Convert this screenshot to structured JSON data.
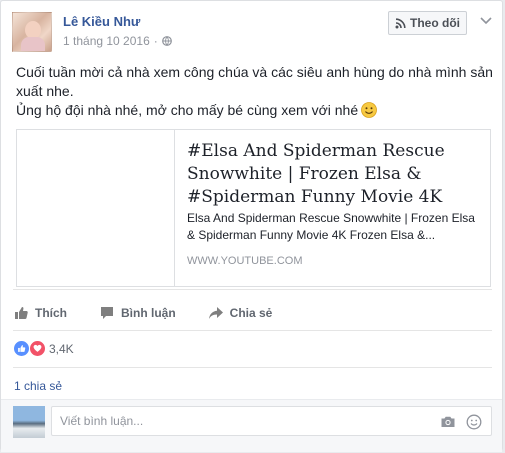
{
  "post": {
    "author": "Lê Kiều Như",
    "timestamp": "1 tháng 10 2016",
    "separator": "·",
    "follow_label": "Theo dõi",
    "message_line1": "Cuối tuần mời cả nhà xem công chúa và các siêu anh hùng do nhà mình sản xuất nhe.",
    "message_line2": "Ủng hộ đội nhà nhé, mở cho mấy bé cùng xem với nhé"
  },
  "link": {
    "title": "#Elsa And Spiderman Rescue Snowwhite | Frozen Elsa & #Spiderman Funny Movie 4K",
    "description": "Elsa And Spiderman Rescue Snowwhite | Frozen Elsa & Spiderman Funny Movie 4K Frozen Elsa &...",
    "domain": "WWW.YOUTUBE.COM"
  },
  "actions": {
    "like": "Thích",
    "comment": "Bình luận",
    "share": "Chia sẻ"
  },
  "stats": {
    "reactions_count": "3,4K",
    "shares": "1 chia sẻ"
  },
  "comment_box": {
    "placeholder": "Viết bình luận..."
  },
  "colors": {
    "link_blue": "#365899",
    "like_blue": "#5890ff",
    "love_red": "#f25268"
  }
}
